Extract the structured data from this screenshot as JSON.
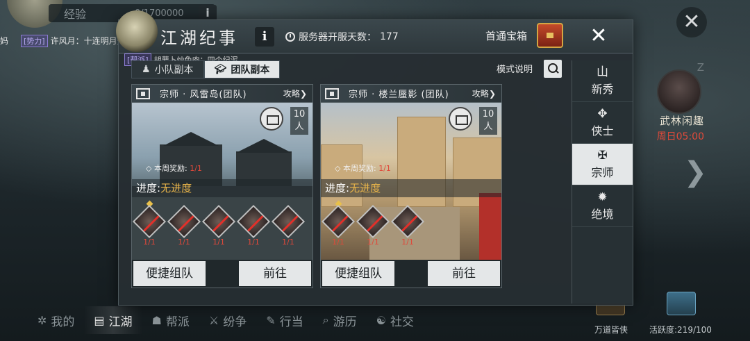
{
  "hud": {
    "exp_label": "经验",
    "exp_value": "0/1700000",
    "info": "i",
    "chat_left_fragment": "妈",
    "chat_force_tag": "[势力]",
    "chat_force_text": "许风月：十连明月天手动不许还",
    "guild_tag": "[帮派]",
    "guild_text": "胡萝卜炒兔肉：四个纪泥",
    "event_title": "武林闲趣",
    "event_time": "周日05:00",
    "z_mark": "Z",
    "right_arrow": "❯",
    "close": "✕"
  },
  "panel": {
    "title": "江湖纪事",
    "info": "i",
    "server_days_label": "服务器开服天数：",
    "server_days_value": "177",
    "first_chest_label": "首通宝箱",
    "close": "✕"
  },
  "tabs": [
    {
      "label": "小队副本",
      "icon": "team-icon",
      "active": false
    },
    {
      "label": "团队副本",
      "icon": "graduation-cap-icon",
      "active": true
    }
  ],
  "mode_explain": "模式说明",
  "dungeons": [
    {
      "name": "宗师 · 风雷岛(团队)",
      "strategy": "攻略",
      "players": "10",
      "players_unit": "人",
      "weekly_label": "本周奖励:",
      "weekly_value": "1/1",
      "progress_label": "进度:",
      "progress_value": "无进度",
      "bosses": [
        "1/1",
        "1/1",
        "1/1",
        "1/1",
        "1/1"
      ],
      "quick_team": "便捷组队",
      "go": "前往"
    },
    {
      "name": "宗师 · 楼兰蜃影 (团队)",
      "strategy": "攻略",
      "players": "10",
      "players_unit": "人",
      "weekly_label": "本周奖励:",
      "weekly_value": "1/1",
      "progress_label": "进度:",
      "progress_value": "无进度",
      "bosses": [
        "1/1",
        "1/1",
        "1/1"
      ],
      "quick_team": "便捷组队",
      "go": "前往"
    }
  ],
  "difficulties": [
    {
      "label": "新秀",
      "icon": "sprout-icon",
      "glyph": "山",
      "active": false
    },
    {
      "label": "侠士",
      "icon": "sword-emblem-icon",
      "glyph": "✥",
      "active": false
    },
    {
      "label": "宗师",
      "icon": "crossed-swords-icon",
      "glyph": "✠",
      "active": true
    },
    {
      "label": "绝境",
      "icon": "skull-emblem-icon",
      "glyph": "✹",
      "active": false
    }
  ],
  "bottom_nav": [
    {
      "label": "我的",
      "icon": "gear-icon",
      "glyph": "✲",
      "active": false
    },
    {
      "label": "江湖",
      "icon": "book-icon",
      "glyph": "▤",
      "active": true
    },
    {
      "label": "帮派",
      "icon": "guild-icon",
      "glyph": "☗",
      "active": false
    },
    {
      "label": "纷争",
      "icon": "crossed-blades-icon",
      "glyph": "⚔",
      "active": false
    },
    {
      "label": "行当",
      "icon": "tools-icon",
      "glyph": "✎",
      "active": false
    },
    {
      "label": "游历",
      "icon": "magnifier-icon",
      "glyph": "⌕",
      "active": false
    },
    {
      "label": "社交",
      "icon": "people-icon",
      "glyph": "☯",
      "active": false
    }
  ],
  "bottom_right": {
    "item_a": "万道皆侠",
    "activity": "活跃度:219/100"
  },
  "colors": {
    "accent_red": "#e0483a",
    "progress_gold": "#e8b44a",
    "active_tab_bg": "#e4e7e8"
  }
}
